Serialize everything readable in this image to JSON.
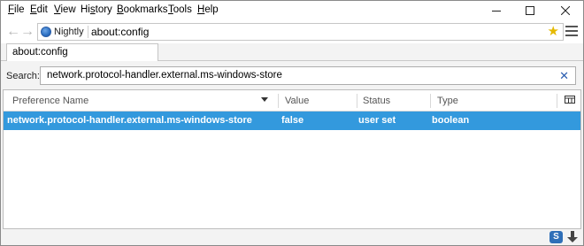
{
  "menu": {
    "items": [
      {
        "first": "F",
        "rest": "ile"
      },
      {
        "first": "E",
        "rest": "dit"
      },
      {
        "first": "V",
        "rest": "iew"
      },
      {
        "first": "",
        "rest": "Hi",
        "u": "s",
        "after": "tory"
      },
      {
        "first": "B",
        "rest": "ookmarks"
      },
      {
        "first": "T",
        "rest": "ools"
      },
      {
        "first": "H",
        "rest": "elp"
      }
    ]
  },
  "navbar": {
    "identity_label": "Nightly",
    "url": "about:config"
  },
  "tab": {
    "label": "about:config"
  },
  "search": {
    "label": "Search:",
    "value": "network.protocol-handler.external.ms-windows-store",
    "clear_symbol": "✕"
  },
  "table": {
    "columns": [
      "Preference Name",
      "Value",
      "Status",
      "Type"
    ],
    "rows": [
      {
        "name": "network.protocol-handler.external.ms-windows-store",
        "value": "false",
        "status": "user set",
        "type": "boolean"
      }
    ],
    "selected_row_color": "#3399dd"
  },
  "statusbar": {
    "s_badge": "S"
  },
  "icons": [
    "back-arrow-icon",
    "forward-arrow-icon",
    "globe-icon",
    "star-icon",
    "hamburger-menu-icon",
    "column-picker-icon",
    "download-icon",
    "minimize-icon",
    "maximize-icon",
    "close-icon"
  ]
}
